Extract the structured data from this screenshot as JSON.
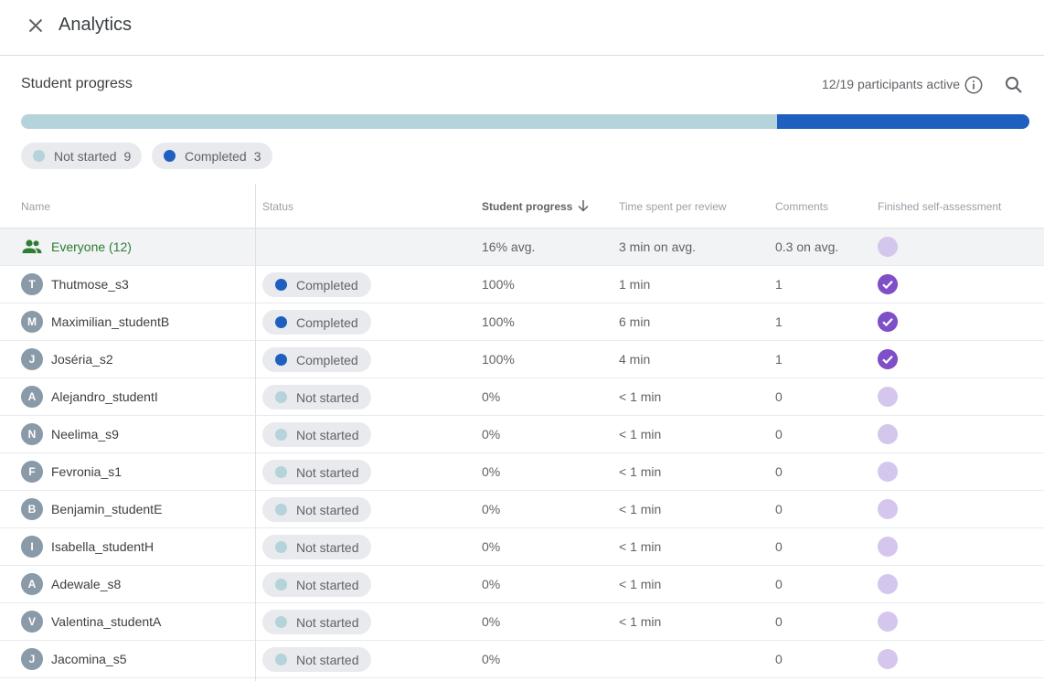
{
  "header": {
    "title": "Analytics"
  },
  "summary": {
    "title": "Student progress",
    "active_text": "12/19 participants active",
    "completed_fraction": 0.25,
    "chips": [
      {
        "label": "Not started",
        "count": "9",
        "color": "#b5d3da"
      },
      {
        "label": "Completed",
        "count": "3",
        "color": "#1f5fbf"
      }
    ]
  },
  "colors": {
    "not_started": "#b5d3da",
    "completed": "#1f5fbf",
    "assess_done": "#7e4fc6",
    "assess_pending": "#d5c6ee",
    "everyone": "#2e7d32"
  },
  "table": {
    "columns": [
      "Name",
      "Status",
      "Student progress",
      "Time spent per review",
      "Comments",
      "Finished self-assessment"
    ],
    "everyone": {
      "name": "Everyone (12)",
      "progress": "16% avg.",
      "time": "3 min on avg.",
      "comments": "0.3 on avg."
    },
    "rows": [
      {
        "initial": "T",
        "name": "Thutmose_s3",
        "status": "Completed",
        "progress": "100%",
        "time": "1 min",
        "comments": "1",
        "assessed": true
      },
      {
        "initial": "M",
        "name": "Maximilian_studentB",
        "status": "Completed",
        "progress": "100%",
        "time": "6 min",
        "comments": "1",
        "assessed": true
      },
      {
        "initial": "J",
        "name": "Joséria_s2",
        "status": "Completed",
        "progress": "100%",
        "time": "4 min",
        "comments": "1",
        "assessed": true
      },
      {
        "initial": "A",
        "name": "Alejandro_studentI",
        "status": "Not started",
        "progress": "0%",
        "time": "< 1 min",
        "comments": "0",
        "assessed": false
      },
      {
        "initial": "N",
        "name": "Neelima_s9",
        "status": "Not started",
        "progress": "0%",
        "time": "< 1 min",
        "comments": "0",
        "assessed": false
      },
      {
        "initial": "F",
        "name": "Fevronia_s1",
        "status": "Not started",
        "progress": "0%",
        "time": "< 1 min",
        "comments": "0",
        "assessed": false
      },
      {
        "initial": "B",
        "name": "Benjamin_studentE",
        "status": "Not started",
        "progress": "0%",
        "time": "< 1 min",
        "comments": "0",
        "assessed": false
      },
      {
        "initial": "I",
        "name": "Isabella_studentH",
        "status": "Not started",
        "progress": "0%",
        "time": "< 1 min",
        "comments": "0",
        "assessed": false
      },
      {
        "initial": "A",
        "name": "Adewale_s8",
        "status": "Not started",
        "progress": "0%",
        "time": "< 1 min",
        "comments": "0",
        "assessed": false
      },
      {
        "initial": "V",
        "name": "Valentina_studentA",
        "status": "Not started",
        "progress": "0%",
        "time": "< 1 min",
        "comments": "0",
        "assessed": false
      },
      {
        "initial": "J",
        "name": "Jacomina_s5",
        "status": "Not started",
        "progress": "0%",
        "time": "",
        "comments": "0",
        "assessed": false
      }
    ]
  }
}
